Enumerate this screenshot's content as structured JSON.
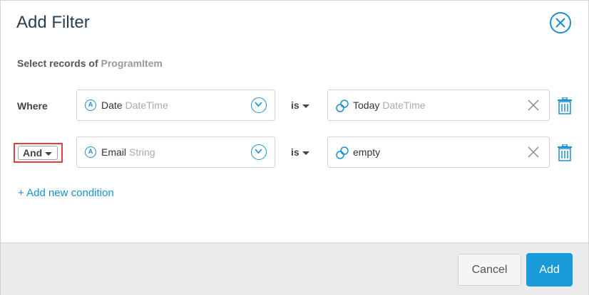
{
  "dialog": {
    "title": "Add Filter",
    "subtitle_prefix": "Select records of",
    "entity": "ProgramItem"
  },
  "conditions": [
    {
      "connector": "Where",
      "field_icon": "A",
      "field_name": "Date",
      "field_type": "DateTime",
      "operator": "is",
      "value": "Today",
      "value_type": "DateTime"
    },
    {
      "connector": "And",
      "field_icon": "A",
      "field_name": "Email",
      "field_type": "String",
      "operator": "is",
      "value": "empty",
      "value_type": ""
    }
  ],
  "add_condition_label": "+ Add new condition",
  "footer": {
    "cancel_label": "Cancel",
    "add_label": "Add"
  },
  "colors": {
    "accent": "#1a9ad9",
    "highlight": "#e0403e"
  }
}
